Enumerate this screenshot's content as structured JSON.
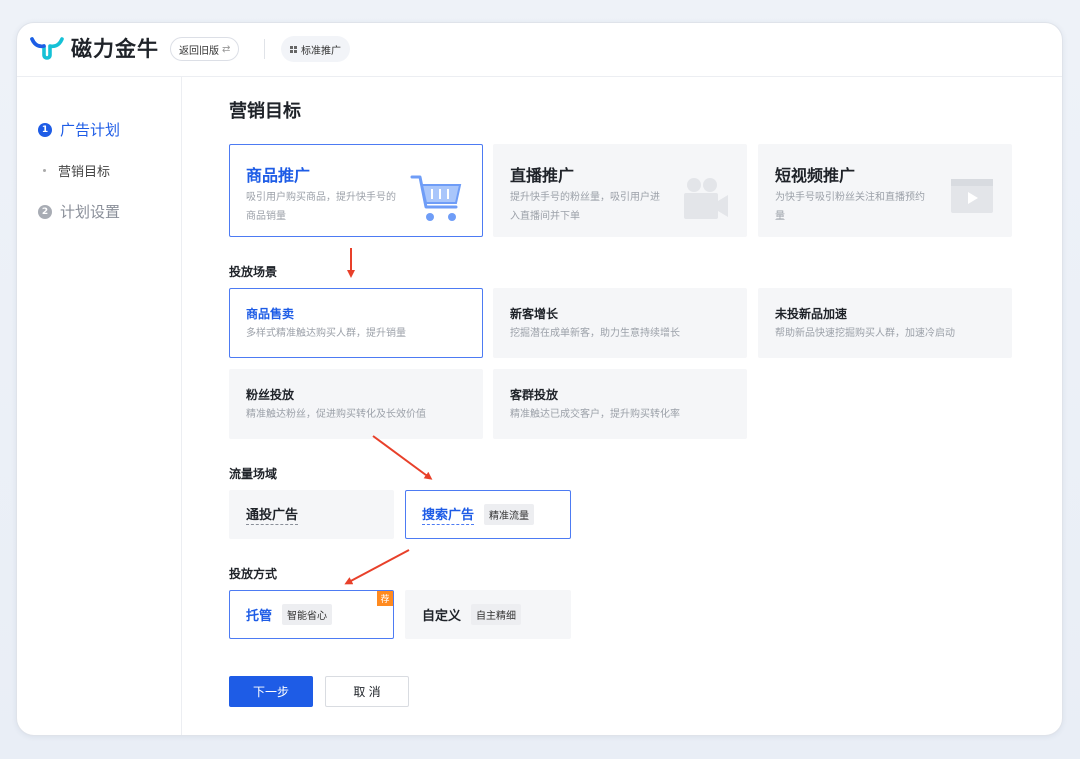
{
  "header": {
    "logo_text": "磁力金牛",
    "old_version_label": "返回旧版",
    "switch_icon": "⇄",
    "standard_tag": "标准推广"
  },
  "sidebar": {
    "steps": [
      {
        "num": "1",
        "label": "广告计划",
        "active": true
      },
      {
        "num": "2",
        "label": "计划设置",
        "active": false
      }
    ],
    "substep": "营销目标"
  },
  "main": {
    "title": "营销目标",
    "goals": [
      {
        "title": "商品推广",
        "desc": "吸引用户购买商品，提升快手号的商品销量",
        "icon": "shopping-cart-icon",
        "selected": true
      },
      {
        "title": "直播推广",
        "desc": "提升快手号的粉丝量，吸引用户进入直播间并下单",
        "icon": "video-camera-icon",
        "selected": false
      },
      {
        "title": "短视频推广",
        "desc": "为快手号吸引粉丝关注和直播预约量",
        "icon": "video-play-icon",
        "selected": false
      }
    ],
    "scene_label": "投放场景",
    "scenes": [
      {
        "title": "商品售卖",
        "desc": "多样式精准触达购买人群，提升销量",
        "selected": true
      },
      {
        "title": "新客增长",
        "desc": "挖掘潜在成单新客，助力生意持续增长",
        "selected": false
      },
      {
        "title": "未投新品加速",
        "desc": "帮助新品快速挖掘购买人群，加速冷启动",
        "selected": false
      },
      {
        "title": "粉丝投放",
        "desc": "精准触达粉丝，促进购买转化及长效价值",
        "selected": false
      },
      {
        "title": "客群投放",
        "desc": "精准触达已成交客户，提升购买转化率",
        "selected": false
      }
    ],
    "traffic_label": "流量场域",
    "traffic": [
      {
        "title": "通投广告",
        "tag": "",
        "selected": false
      },
      {
        "title": "搜索广告",
        "tag": "精准流量",
        "selected": true
      }
    ],
    "method_label": "投放方式",
    "methods": [
      {
        "title": "托管",
        "tag": "智能省心",
        "badge": "荐",
        "selected": true
      },
      {
        "title": "自定义",
        "tag": "自主精细",
        "selected": false
      }
    ],
    "next_button": "下一步",
    "cancel_button": "取 消"
  },
  "colors": {
    "primary": "#1e5ce6",
    "arrow": "#e8402a",
    "badge": "#ff8a1f"
  }
}
